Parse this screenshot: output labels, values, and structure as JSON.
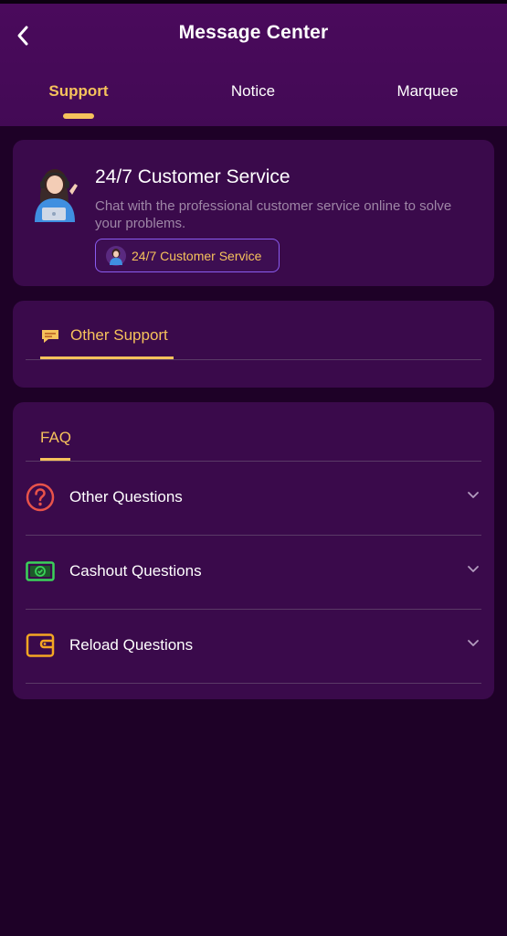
{
  "header": {
    "title": "Message Center",
    "back_icon": "chevron-left-icon"
  },
  "tabs": [
    {
      "label": "Support",
      "active": true
    },
    {
      "label": "Notice",
      "active": false
    },
    {
      "label": "Marquee",
      "active": false
    }
  ],
  "customer_service": {
    "title": "24/7 Customer Service",
    "description": "Chat with the professional customer service online to solve your problems.",
    "button_label": "24/7 Customer Service",
    "avatar_icon": "support-agent-avatar"
  },
  "other_support": {
    "label": "Other Support",
    "icon": "chat-bubble-icon"
  },
  "faq": {
    "title": "FAQ",
    "items": [
      {
        "label": "Other Questions",
        "icon": "question-circle-icon",
        "icon_color": "#e8534a"
      },
      {
        "label": "Cashout Questions",
        "icon": "cash-icon",
        "icon_color": "#3bd15a"
      },
      {
        "label": "Reload Questions",
        "icon": "wallet-icon",
        "icon_color": "#f5a623"
      }
    ]
  },
  "colors": {
    "accent": "#f6c25c",
    "header_bg": "#4a0a5c",
    "card_bg": "#3a0a4b",
    "page_bg": "#1e0127",
    "button_border": "#8a5cf0"
  }
}
